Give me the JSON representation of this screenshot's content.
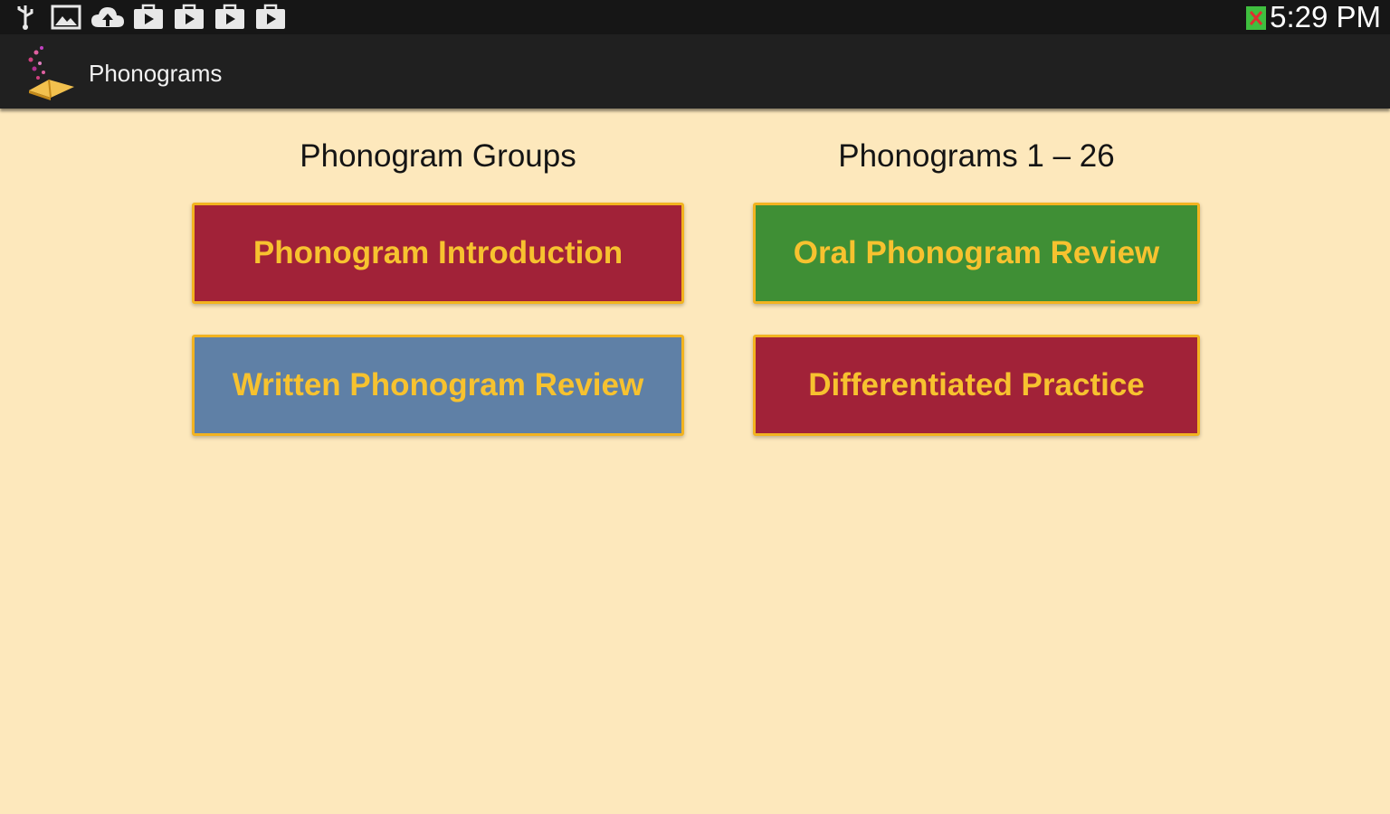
{
  "status_bar": {
    "time": "5:29 PM",
    "icons": [
      "usb-icon",
      "image-icon",
      "cloud-upload-icon",
      "play-store-icon",
      "play-store-icon",
      "play-store-icon",
      "play-store-icon",
      "battery-alert-icon"
    ]
  },
  "action_bar": {
    "title": "Phonograms",
    "logo_icon": "book-with-sparkles-icon"
  },
  "main": {
    "columns": [
      {
        "heading": "Phonogram Groups"
      },
      {
        "heading": "Phonograms 1 – 26"
      }
    ],
    "buttons": [
      {
        "label": "Phonogram Introduction",
        "color": "#a12238"
      },
      {
        "label": "Oral Phonogram Review",
        "color": "#3f8f35"
      },
      {
        "label": "Written Phonogram Review",
        "color": "#5f80a6"
      },
      {
        "label": "Differentiated Practice",
        "color": "#a12238"
      }
    ],
    "text_color": "#f7c22f",
    "border_color": "#f2b320",
    "background": "#fde8bc"
  }
}
